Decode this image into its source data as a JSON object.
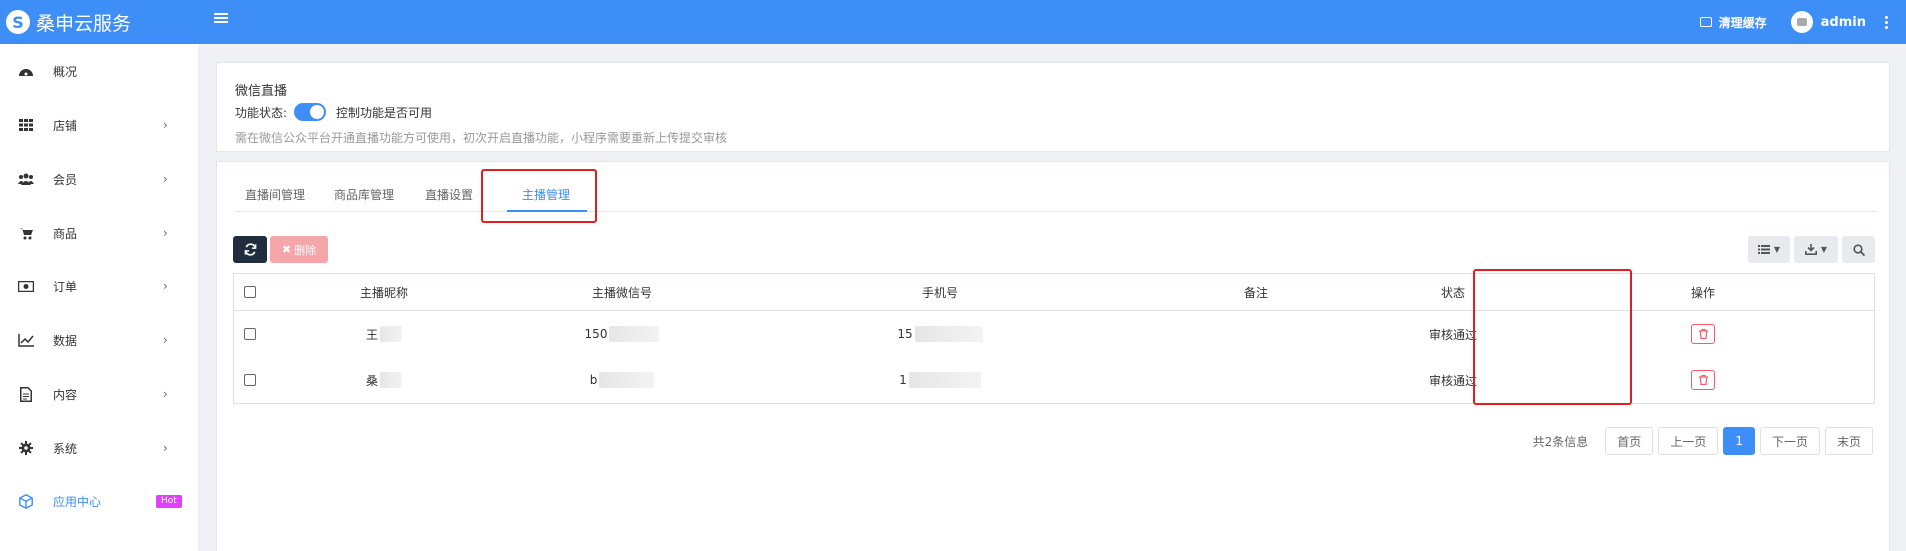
{
  "header": {
    "brand": "桑申云服务",
    "clear_cache": "清理缓存",
    "username": "admin"
  },
  "sidebar": {
    "items": [
      {
        "label": "概况",
        "icon": "dashboard-icon",
        "has_children": false
      },
      {
        "label": "店铺",
        "icon": "grid-icon",
        "has_children": true
      },
      {
        "label": "会员",
        "icon": "users-icon",
        "has_children": true
      },
      {
        "label": "商品",
        "icon": "cart-icon",
        "has_children": true
      },
      {
        "label": "订单",
        "icon": "money-icon",
        "has_children": true
      },
      {
        "label": "数据",
        "icon": "line-chart-icon",
        "has_children": true
      },
      {
        "label": "内容",
        "icon": "document-icon",
        "has_children": true
      },
      {
        "label": "系统",
        "icon": "gear-icon",
        "has_children": true
      },
      {
        "label": "应用中心",
        "icon": "cube-icon",
        "active": true,
        "badge": "Hot"
      }
    ]
  },
  "plugin": {
    "title": "微信直播",
    "status_label": "功能状态:",
    "status_on": true,
    "status_desc": "控制功能是否可用",
    "note": "需在微信公众平台开通直播功能方可使用，初次开启直播功能，小程序需要重新上传提交审核"
  },
  "tabs": [
    {
      "label": "直播间管理",
      "active": false
    },
    {
      "label": "商品库管理",
      "active": false
    },
    {
      "label": "直播设置",
      "active": false
    },
    {
      "label": "主播管理",
      "active": true
    }
  ],
  "toolbar": {
    "delete_label": "删除"
  },
  "table": {
    "columns": [
      "主播昵称",
      "主播微信号",
      "手机号",
      "备注",
      "状态",
      "操作"
    ],
    "rows": [
      {
        "nickname": "王",
        "wechat": "150",
        "phone": "15",
        "remark": "",
        "status": "审核通过"
      },
      {
        "nickname": "桑",
        "wechat": "b",
        "phone": "1",
        "remark": "",
        "status": "审核通过"
      }
    ]
  },
  "pagination": {
    "total_text": "共2条信息",
    "first": "首页",
    "prev": "上一页",
    "current": "1",
    "next": "下一页",
    "last": "末页"
  },
  "colors": {
    "primary": "#3e8ef7",
    "danger": "#f35b6a",
    "highlight": "#e02020"
  }
}
